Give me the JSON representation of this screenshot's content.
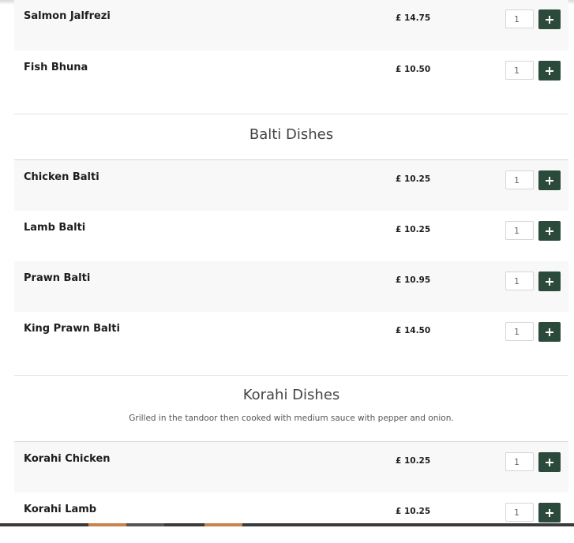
{
  "sections": [
    {
      "title": "",
      "items": [
        {
          "name": "Salmon Jalfrezi",
          "price": "£ 14.75",
          "qty": "1"
        },
        {
          "name": "Fish Bhuna",
          "price": "£ 10.50",
          "qty": "1"
        }
      ]
    },
    {
      "title": "Balti Dishes",
      "items": [
        {
          "name": "Chicken Balti",
          "price": "£ 10.25",
          "qty": "1"
        },
        {
          "name": "Lamb Balti",
          "price": "£ 10.25",
          "qty": "1"
        },
        {
          "name": "Prawn Balti",
          "price": "£ 10.95",
          "qty": "1"
        },
        {
          "name": "King Prawn Balti",
          "price": "£ 14.50",
          "qty": "1"
        }
      ]
    },
    {
      "title": "Korahi Dishes",
      "description": "Grilled in the tandoor then cooked with medium sauce with pepper and onion.",
      "items": [
        {
          "name": "Korahi Chicken",
          "price": "£ 10.25",
          "qty": "1"
        },
        {
          "name": "Korahi Lamb",
          "price": "£ 10.25",
          "qty": "1"
        }
      ]
    }
  ],
  "icons": {
    "add": "plus-icon"
  },
  "colors": {
    "add_button": "#2b4a3b",
    "alt_row": "#f8f8f8",
    "bottom_accent": "#c8824a"
  }
}
